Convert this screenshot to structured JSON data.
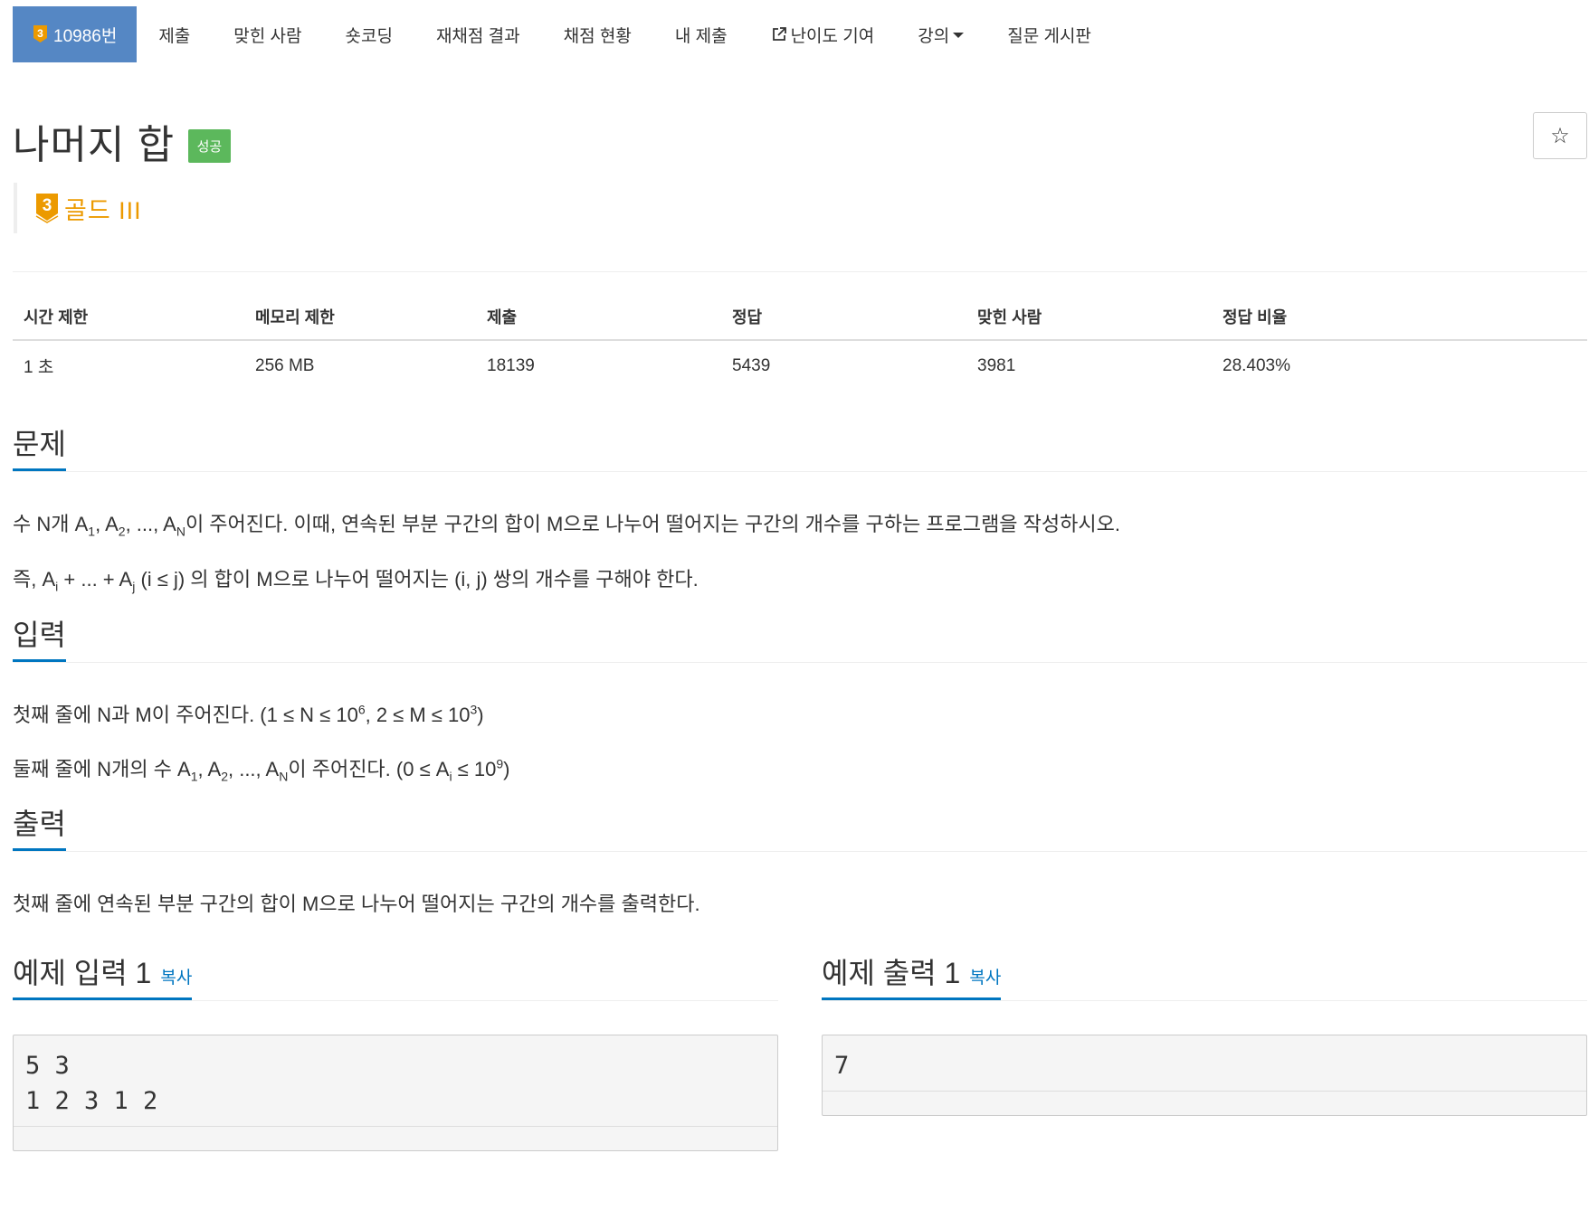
{
  "nav": {
    "problem_number": "10986번",
    "items": [
      "제출",
      "맞힌 사람",
      "숏코딩",
      "재채점 결과",
      "채점 현황",
      "내 제출",
      "난이도 기여",
      "강의",
      "질문 게시판"
    ],
    "tier_digit": "3"
  },
  "title": "나머지 합",
  "status_label": "성공",
  "star": "☆",
  "tier": {
    "digit": "3",
    "label": "골드 III",
    "color": "#ec9a00"
  },
  "info_table": {
    "headers": [
      "시간 제한",
      "메모리 제한",
      "제출",
      "정답",
      "맞힌 사람",
      "정답 비율"
    ],
    "values": [
      "1 초",
      "256 MB",
      "18139",
      "5439",
      "3981",
      "28.403%"
    ]
  },
  "problem": {
    "heading": "문제",
    "p1": {
      "before": "수 N개 A",
      "s1": "1",
      "m1": ", A",
      "s2": "2",
      "m2": ", ..., A",
      "s3": "N",
      "after": "이 주어진다. 이때, 연속된 부분 구간의 합이 M으로 나누어 떨어지는 구간의 개수를 구하는 프로그램을 작성하시오."
    },
    "p2": {
      "before": "즉, A",
      "s1": "i",
      "mid": " + ... + A",
      "s2": "j",
      "after": " (i ≤ j) 의 합이 M으로 나누어 떨어지는 (i, j) 쌍의 개수를 구해야 한다."
    }
  },
  "input": {
    "heading": "입력",
    "p1": {
      "before": "첫째 줄에 N과 M이 주어진다. (1 ≤ N ≤ 10",
      "sup1": "6",
      "mid": ", 2 ≤ M ≤ 10",
      "sup2": "3",
      "after": ")"
    },
    "p2": {
      "before": "둘째 줄에 N개의 수 A",
      "s1": "1",
      "m1": ", A",
      "s2": "2",
      "m2": ", ..., A",
      "s3": "N",
      "m3": "이 주어진다. (0 ≤ A",
      "s4": "i",
      "m4": " ≤ 10",
      "sup": "9",
      "after": ")"
    }
  },
  "output": {
    "heading": "출력",
    "text": "첫째 줄에 연속된 부분 구간의 합이 M으로 나누어 떨어지는 구간의 개수를 출력한다."
  },
  "sample_input": {
    "heading": "예제 입력 1",
    "copy": "복사",
    "content": "5 3\n1 2 3 1 2"
  },
  "sample_output": {
    "heading": "예제 출력 1",
    "copy": "복사",
    "content": "7"
  },
  "colors": {
    "nav_active": "#5587c4",
    "success": "#5cb85c",
    "link": "#0076c0",
    "gold": "#ec9a00"
  }
}
